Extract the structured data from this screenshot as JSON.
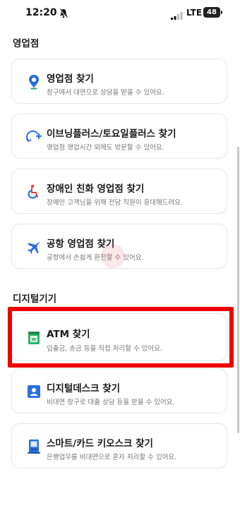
{
  "status_bar": {
    "time": "12:20",
    "network": "LTE",
    "battery": "48"
  },
  "sections": {
    "branch": {
      "title": "영업점",
      "items": [
        {
          "title": "영업점 찾기",
          "desc": "창구에서 대면으로 상담을 받을 수 있어요."
        },
        {
          "title": "이브닝플러스/토요일플러스 찾기",
          "desc": "영업점 영업시간 외에도 방문할 수 있어요."
        },
        {
          "title": "장애인 친화 영업점 찾기",
          "desc": "장애인 고객님을 위해 전담 직원이 응대해드려요."
        },
        {
          "title": "공항 영업점 찾기",
          "desc": "공항에서 손쉽게 환전할 수 있어요."
        }
      ]
    },
    "digital": {
      "title": "디지털기기",
      "items": [
        {
          "title": "ATM 찾기",
          "desc": "입출금, 송금 등을 직접 처리할 수 있어요."
        },
        {
          "title": "디지털데스크 찾기",
          "desc": "비대면 창구로 대출 상담 등을 받을 수 있어요."
        },
        {
          "title": "스마트/카드 키오스크 찾기",
          "desc": "은행업무를 비대면으로 혼자 처리할 수 있어요."
        }
      ]
    }
  },
  "colors": {
    "highlight": "#ee0000",
    "accent_blue": "#2a6fdc",
    "atm_green": "#2fb36b"
  }
}
